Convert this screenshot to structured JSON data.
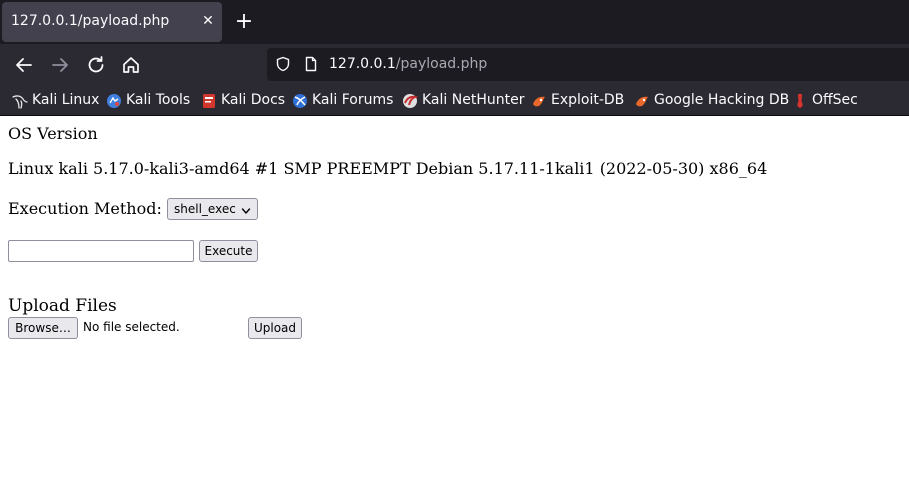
{
  "browser": {
    "tab": {
      "title": "127.0.0.1/payload.php",
      "close_glyph": "✕"
    },
    "new_tab_glyph": "+",
    "nav_icons": [
      "back-arrow-icon",
      "forward-arrow-icon",
      "reload-icon",
      "home-icon"
    ],
    "url": {
      "host": "127.0.0.1",
      "path": "/payload.php"
    },
    "bookmarks": [
      {
        "label": "Kali Linux",
        "icon": "kali-dragon-icon"
      },
      {
        "label": "Kali Tools",
        "icon": "kali-tools-icon"
      },
      {
        "label": "Kali Docs",
        "icon": "kali-docs-icon"
      },
      {
        "label": "Kali Forums",
        "icon": "kali-forums-icon"
      },
      {
        "label": "Kali NetHunter",
        "icon": "kali-nethunter-icon"
      },
      {
        "label": "Exploit-DB",
        "icon": "exploit-db-icon"
      },
      {
        "label": "Google Hacking DB",
        "icon": "ghdb-icon"
      },
      {
        "label": "OffSec",
        "icon": "offsec-icon"
      }
    ],
    "colors": {
      "tabstrip_bg": "#1c1b22",
      "toolbar_bg": "#2b2a33",
      "active_tab_bg": "#42414d",
      "text": "#fbfbfe"
    }
  },
  "page": {
    "os_heading": "OS Version",
    "os_string": "Linux kali 5.17.0-kali3-amd64 #1 SMP PREEMPT Debian 5.17.11-1kali1 (2022-05-30) x86_64",
    "execution_label": "Execution Method:",
    "execution_selected": "shell_exec",
    "command_value": "",
    "execute_label": "Execute",
    "upload_heading": "Upload Files",
    "browse_label": "Browse…",
    "no_file_text": "No file selected.",
    "upload_label": "Upload"
  }
}
